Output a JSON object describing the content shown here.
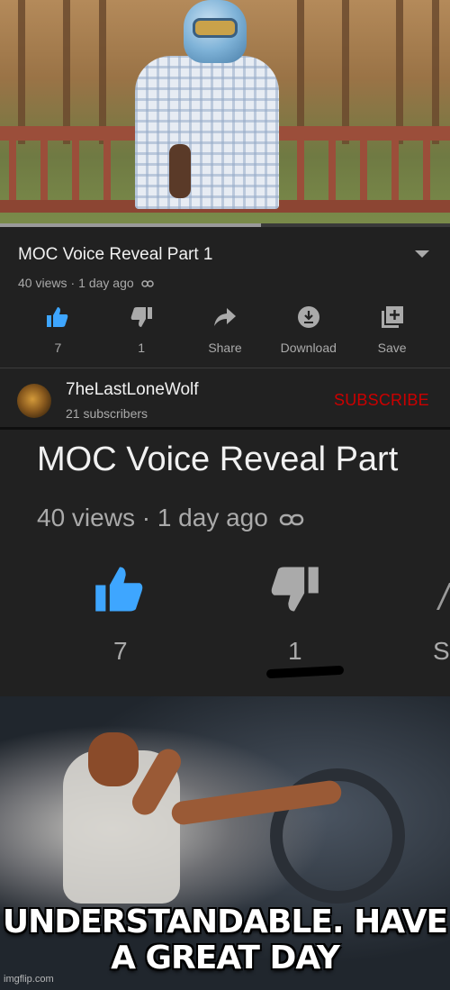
{
  "video": {
    "title": "MOC Voice Reveal Part 1",
    "views": "40 views",
    "separator": " · ",
    "age": "1 day ago",
    "progress_fraction": 0.05,
    "buffered_fraction": 0.58
  },
  "actions": [
    {
      "icon": "thumb-up-icon",
      "label": "7"
    },
    {
      "icon": "thumb-down-icon",
      "label": "1"
    },
    {
      "icon": "share-icon",
      "label": "Share"
    },
    {
      "icon": "download-icon",
      "label": "Download"
    },
    {
      "icon": "save-playlist-icon",
      "label": "Save"
    }
  ],
  "channel": {
    "name": "7heLastLoneWolf",
    "subscribers": "21 subscribers",
    "subscribe_label": "SUBSCRIBE"
  },
  "zoom": {
    "title": "MOC Voice Reveal Part",
    "meta": "40 views · 1 day ago",
    "like_count": "7",
    "dislike_count": "1",
    "partial_label": "S"
  },
  "meme": {
    "line1": "UNDERSTANDABLE. HAVE",
    "line2": "A GREAT DAY",
    "watermark": "imgflip.com"
  },
  "colors": {
    "accent_blue": "#3ea6ff",
    "subscribe_red": "#cc0000",
    "progress_red": "#ff0000",
    "panel_bg": "#212121"
  }
}
